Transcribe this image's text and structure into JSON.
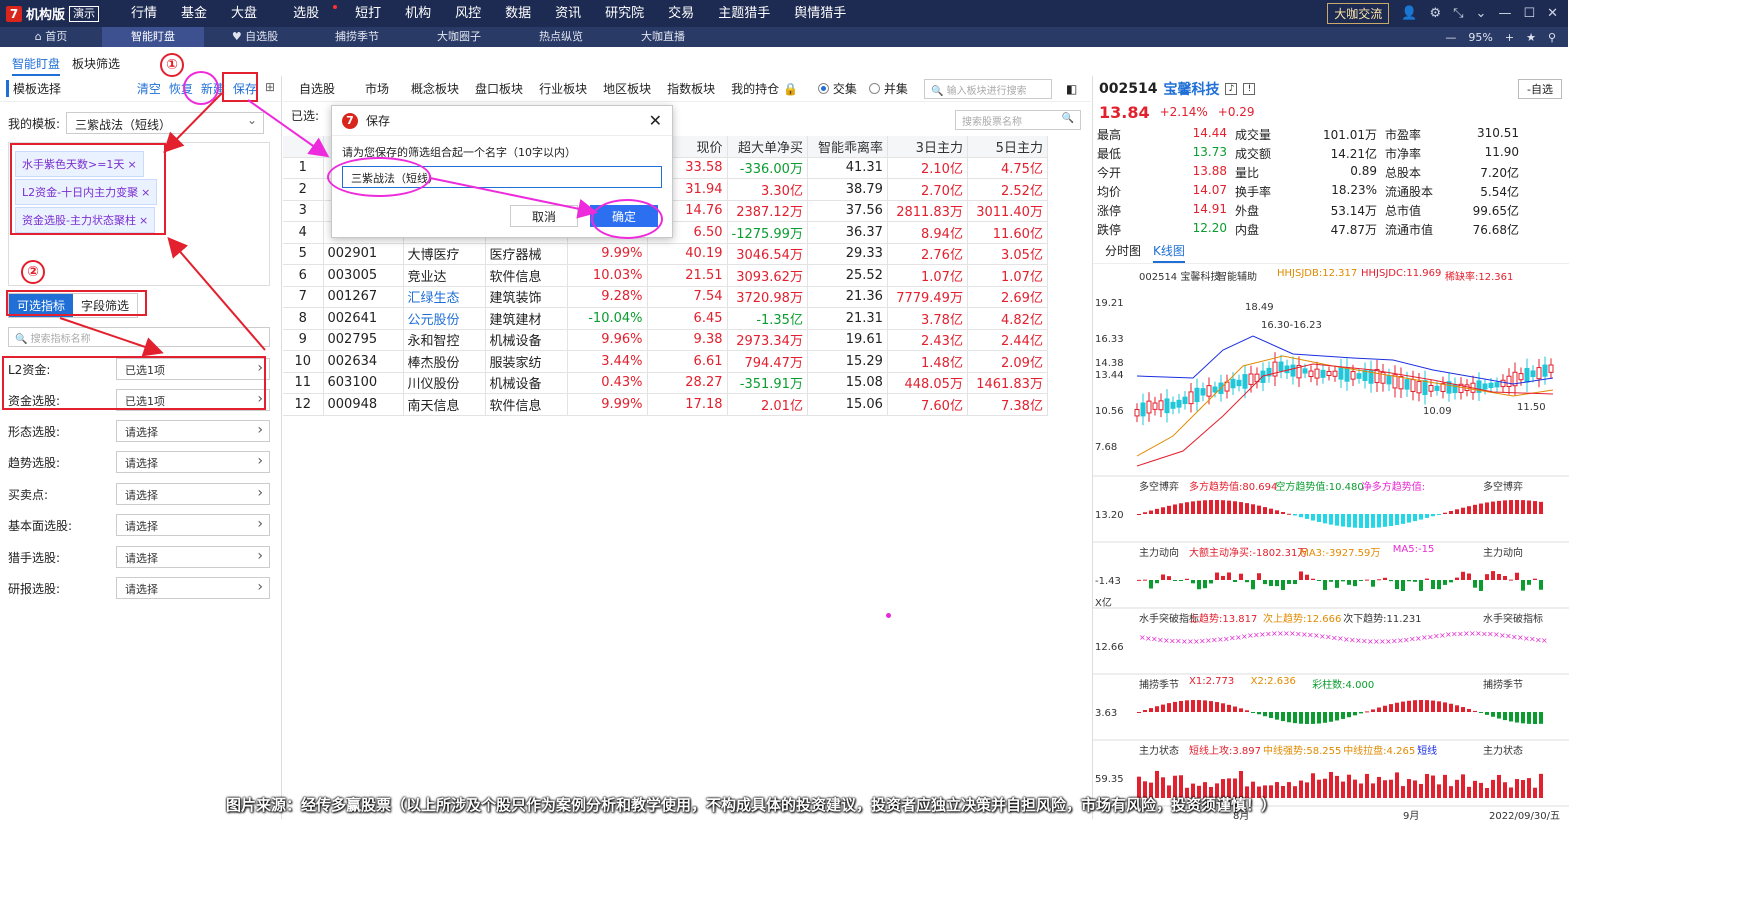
{
  "app": {
    "logo_text": "机构版",
    "demo_badge": "演示",
    "menu": [
      "行情",
      "基金",
      "大盘",
      "选股",
      "短打",
      "机构",
      "风控",
      "数据",
      "资讯",
      "研究院",
      "交易",
      "主题猎手",
      "舆情猎手"
    ],
    "dk_btn": "大咖交流"
  },
  "subtabs": [
    "首页",
    "智能盯盘",
    "自选股",
    "捕捞季节",
    "大咖圈子",
    "热点纵览",
    "大咖直播"
  ],
  "zoom": "95%",
  "left": {
    "tabs": [
      "智能盯盘",
      "板块筛选"
    ],
    "template_title": "模板选择",
    "actions": [
      "清空",
      "恢复",
      "新建",
      "保存"
    ],
    "my_template_label": "我的模板:",
    "my_template_value": "三紫战法（短线）",
    "chips": [
      "水手紫色天数>=1天",
      "L2资金-十日内主力变聚",
      "资金选股-主力状态聚柱"
    ],
    "sel_tabs": [
      "可选指标",
      "字段筛选"
    ],
    "search_placeholder": "搜索指标名称",
    "filters": [
      {
        "label": "L2资金:",
        "value": "已选1项"
      },
      {
        "label": "资金选股:",
        "value": "已选1项"
      },
      {
        "label": "形态选股:",
        "value": "请选择"
      },
      {
        "label": "趋势选股:",
        "value": "请选择"
      },
      {
        "label": "买卖点:",
        "value": "请选择"
      },
      {
        "label": "基本面选股:",
        "value": "请选择"
      },
      {
        "label": "猎手选股:",
        "value": "请选择"
      },
      {
        "label": "研报选股:",
        "value": "请选择"
      }
    ],
    "callouts": [
      "①",
      "②"
    ]
  },
  "center": {
    "tabs": [
      "自选股",
      "市场",
      "概念板块",
      "盘口板块",
      "行业板块",
      "地区板块",
      "指数板块",
      "我的持仓"
    ],
    "radio_and": "交集",
    "radio_or": "并集",
    "block_search": "输入板块进行搜索",
    "selected_label": "已选:",
    "stock_search": "搜索股票名称",
    "headers": [
      "现价",
      "超大单净买",
      "智能乖离率",
      "3日主力",
      "5日主力"
    ],
    "rows": [
      {
        "i": "1",
        "code": "",
        "name": "",
        "ind": "",
        "chg": "",
        "price": "33.58",
        "big": "-336.00万",
        "bias": "41.31",
        "d3": "2.10亿",
        "d5": "4.75亿"
      },
      {
        "i": "2",
        "code": "",
        "name": "",
        "ind": "",
        "chg": "",
        "price": "31.94",
        "big": "3.30亿",
        "bias": "38.79",
        "d3": "2.70亿",
        "d5": "2.52亿"
      },
      {
        "i": "3",
        "code": "",
        "name": "",
        "ind": "",
        "chg": "",
        "price": "14.76",
        "big": "2387.12万",
        "bias": "37.56",
        "d3": "2811.83万",
        "d5": "3011.40万"
      },
      {
        "i": "4",
        "code": "",
        "name": "",
        "ind": "",
        "chg": "",
        "price": "6.50",
        "big": "-1275.99万",
        "bias": "36.37",
        "d3": "8.94亿",
        "d5": "11.60亿"
      },
      {
        "i": "5",
        "code": "002901",
        "name": "大博医疗",
        "ind": "医疗器械",
        "chg": "9.99%",
        "price": "40.19",
        "big": "3046.54万",
        "bias": "29.33",
        "d3": "2.76亿",
        "d5": "3.05亿"
      },
      {
        "i": "6",
        "code": "003005",
        "name": "竞业达",
        "ind": "软件信息",
        "chg": "10.03%",
        "price": "21.51",
        "big": "3093.62万",
        "bias": "25.52",
        "d3": "1.07亿",
        "d5": "1.07亿"
      },
      {
        "i": "7",
        "code": "001267",
        "name": "汇绿生态",
        "ind": "建筑装饰",
        "chg": "9.28%",
        "price": "7.54",
        "big": "3720.98万",
        "bias": "21.36",
        "d3": "7779.49万",
        "d5": "2.69亿"
      },
      {
        "i": "8",
        "code": "002641",
        "name": "公元股份",
        "ind": "建筑建材",
        "chg": "-10.04%",
        "price": "6.45",
        "big": "-1.35亿",
        "bias": "21.31",
        "d3": "3.78亿",
        "d5": "4.82亿"
      },
      {
        "i": "9",
        "code": "002795",
        "name": "永和智控",
        "ind": "机械设备",
        "chg": "9.96%",
        "price": "9.38",
        "big": "2973.34万",
        "bias": "19.61",
        "d3": "2.43亿",
        "d5": "2.44亿"
      },
      {
        "i": "10",
        "code": "002634",
        "name": "棒杰股份",
        "ind": "服装家纺",
        "chg": "3.44%",
        "price": "6.61",
        "big": "794.47万",
        "bias": "15.29",
        "d3": "1.48亿",
        "d5": "2.09亿"
      },
      {
        "i": "11",
        "code": "603100",
        "name": "川仪股份",
        "ind": "机械设备",
        "chg": "0.43%",
        "price": "28.27",
        "big": "-351.91万",
        "bias": "15.08",
        "d3": "448.05万",
        "d5": "1461.83万"
      },
      {
        "i": "12",
        "code": "000948",
        "name": "南天信息",
        "ind": "软件信息",
        "chg": "9.99%",
        "price": "17.18",
        "big": "2.01亿",
        "bias": "15.06",
        "d3": "7.60亿",
        "d5": "7.38亿"
      }
    ]
  },
  "dialog": {
    "title": "保存",
    "prompt": "请为您保存的筛选组合起一个名字（10字以内）",
    "input_value": "三紫战法（短线）",
    "cancel": "取消",
    "ok": "确定"
  },
  "right": {
    "code": "002514",
    "name": "宝馨科技",
    "zx_btn": "-自选",
    "price": "13.84",
    "pct": "+2.14%",
    "chg": "+0.29",
    "quotes": [
      [
        "最高",
        "14.44",
        "成交量",
        "101.01万",
        "市盈率",
        "310.51"
      ],
      [
        "最低",
        "13.73",
        "成交额",
        "14.21亿",
        "市净率",
        "11.90"
      ],
      [
        "今开",
        "13.88",
        "量比",
        "0.89",
        "总股本",
        "7.20亿"
      ],
      [
        "均价",
        "14.07",
        "换手率",
        "18.23%",
        "流通股本",
        "5.54亿"
      ],
      [
        "涨停",
        "14.91",
        "外盘",
        "53.14万",
        "总市值",
        "99.65亿"
      ],
      [
        "跌停",
        "12.20",
        "内盘",
        "47.87万",
        "流通市值",
        "76.68亿"
      ]
    ],
    "ktabs": [
      "分时图",
      "K线图"
    ],
    "kchart": {
      "legend": [
        "002514 宝馨科技",
        "智能辅助",
        "HHJSJDB:12.317",
        "HHJSJDC:11.969",
        "稀缺率:12.361"
      ],
      "y_labels": [
        "19.21",
        "16.33",
        "14.38",
        "13.44",
        "10.56",
        "7.68"
      ],
      "ann": [
        "18.49",
        "16.30-16.23",
        "10.09",
        "11.50"
      ]
    },
    "panels": [
      {
        "title": "多空博弈",
        "items": [
          "多方趋势值:80.694",
          "空方趋势值:10.480",
          "净多方趋势值:"
        ],
        "y": "13.20"
      },
      {
        "title": "主力动向",
        "items": [
          "大额主动净买:-1802.31万",
          "MA3:-3927.59万",
          "MA5:-15"
        ],
        "y": "-1.43",
        "unit": "X亿"
      },
      {
        "title": "水手突破指标",
        "items": [
          "上趋势:13.817",
          "次上趋势:12.666",
          "次下趋势:11.231"
        ],
        "y": "12.66"
      },
      {
        "title": "捕捞季节",
        "items": [
          "X1:2.773",
          "X2:2.636",
          "彩柱数:4.000"
        ],
        "y": "3.63"
      },
      {
        "title": "主力状态",
        "items": [
          "短线上攻:3.897",
          "中线强势:58.255",
          "中线拉盘:4.265",
          "短线"
        ],
        "y": "59.35"
      }
    ],
    "x_labels": [
      "8月",
      "9月"
    ],
    "date": "2022/09/30/五"
  },
  "caption": "图片来源：经传多赢股票（以上所涉及个股只作为案例分析和教学使用，不构成具体的投资建议，投资者应独立决策并自担风险，市场有风险，投资须谨慎！）"
}
